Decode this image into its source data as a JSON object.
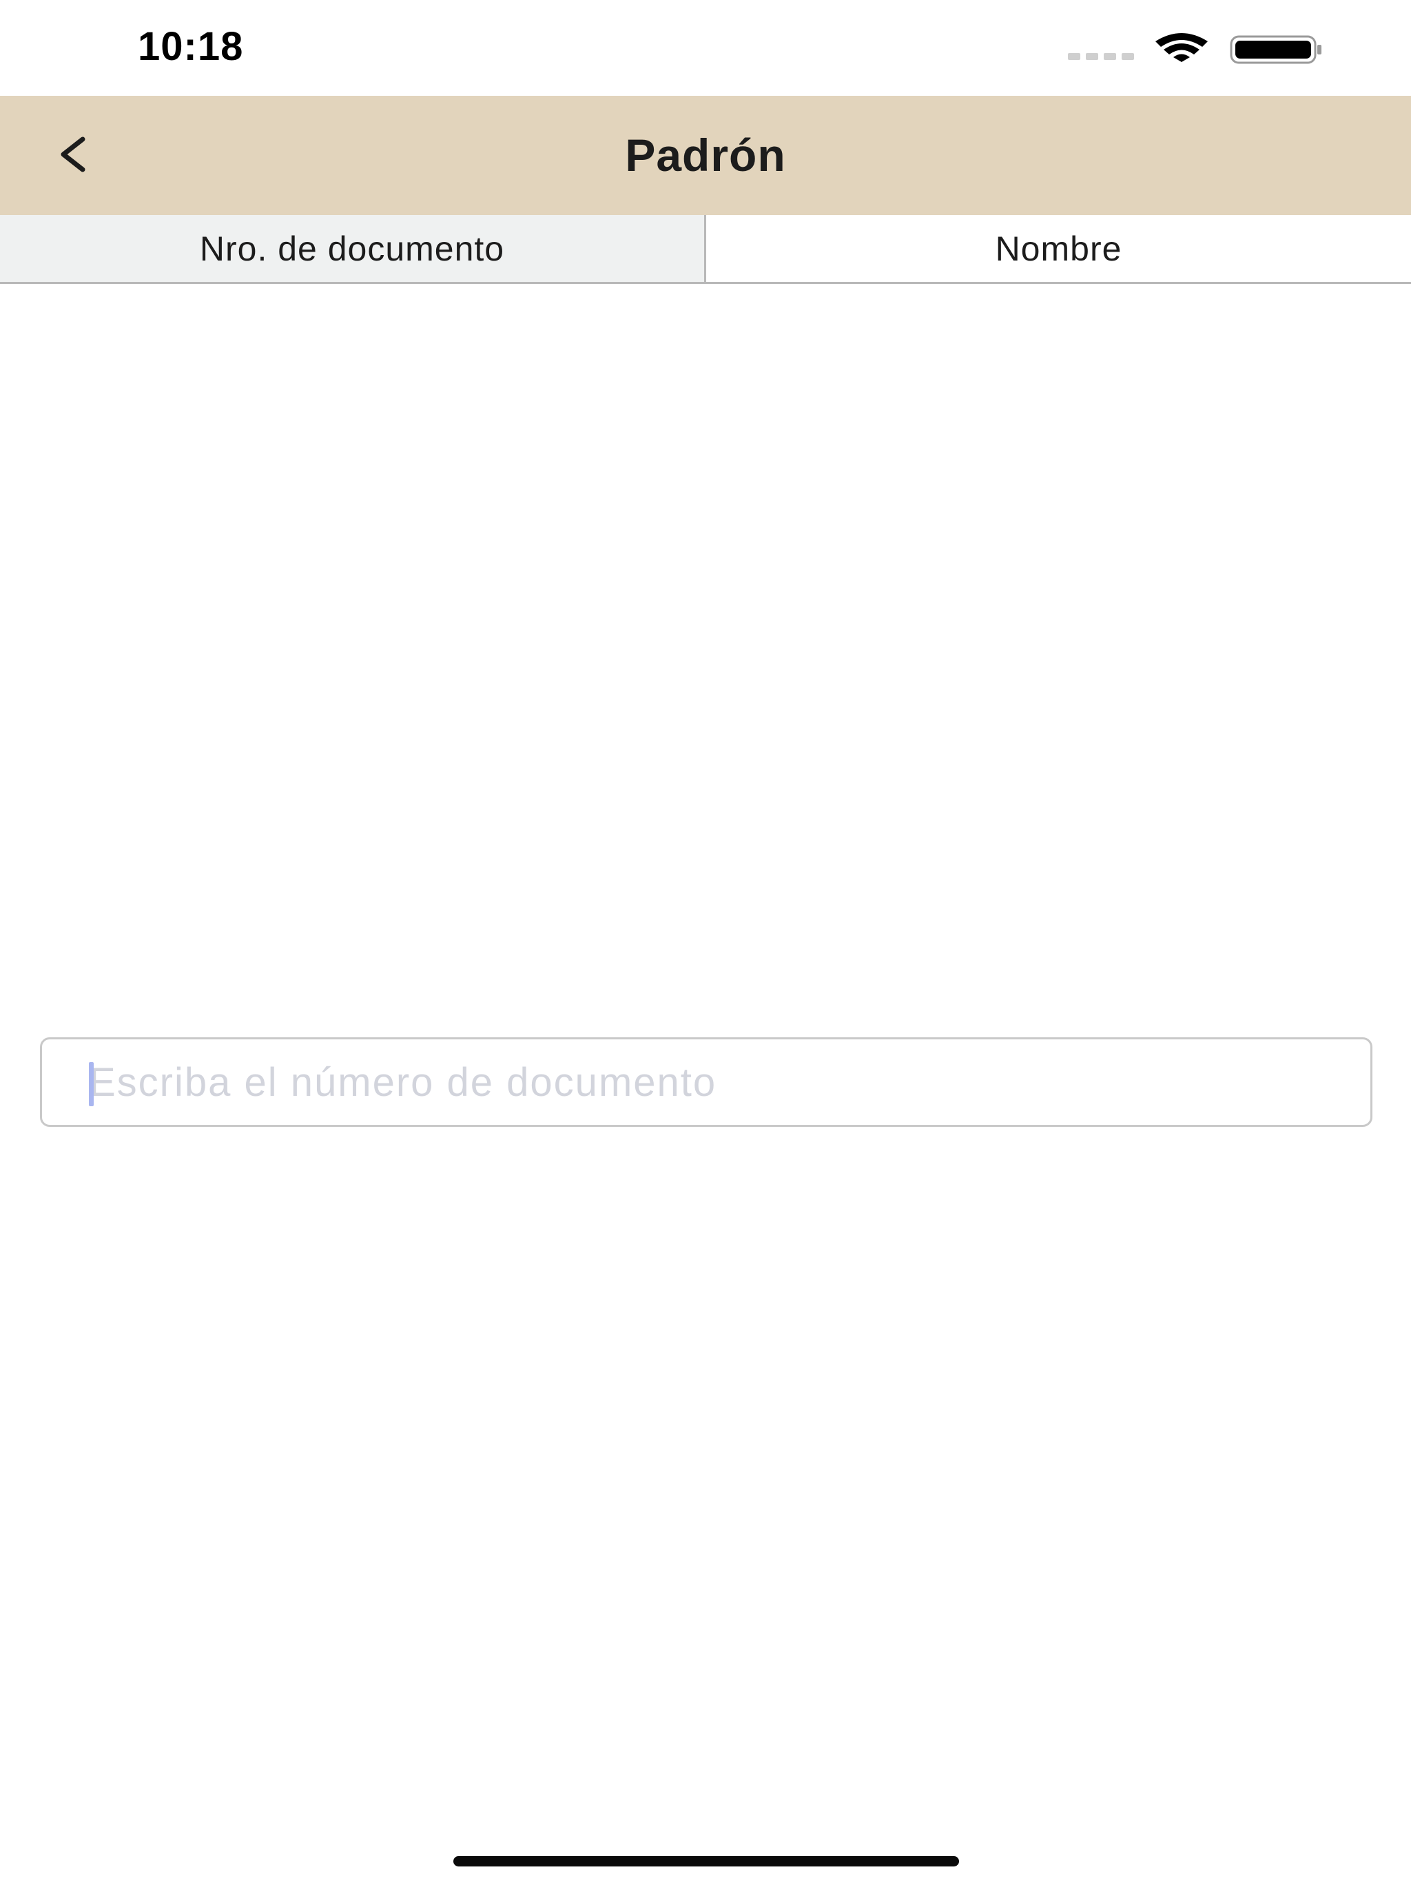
{
  "status_bar": {
    "time": "10:18",
    "icons": [
      "signal-icon",
      "wifi-icon",
      "battery-icon"
    ]
  },
  "header": {
    "title": "Padrón",
    "back_icon": "chevron-left-icon",
    "background_color": "#e2d4bc"
  },
  "tabs": [
    {
      "label": "Nro. de documento",
      "selected": true
    },
    {
      "label": "Nombre",
      "selected": false
    }
  ],
  "search": {
    "placeholder": "Escriba el número de documento",
    "value": ""
  },
  "colors": {
    "tab_selected_bg": "#eff1f1",
    "caret": "#a9b6f0",
    "placeholder": "#d2d4dc"
  }
}
